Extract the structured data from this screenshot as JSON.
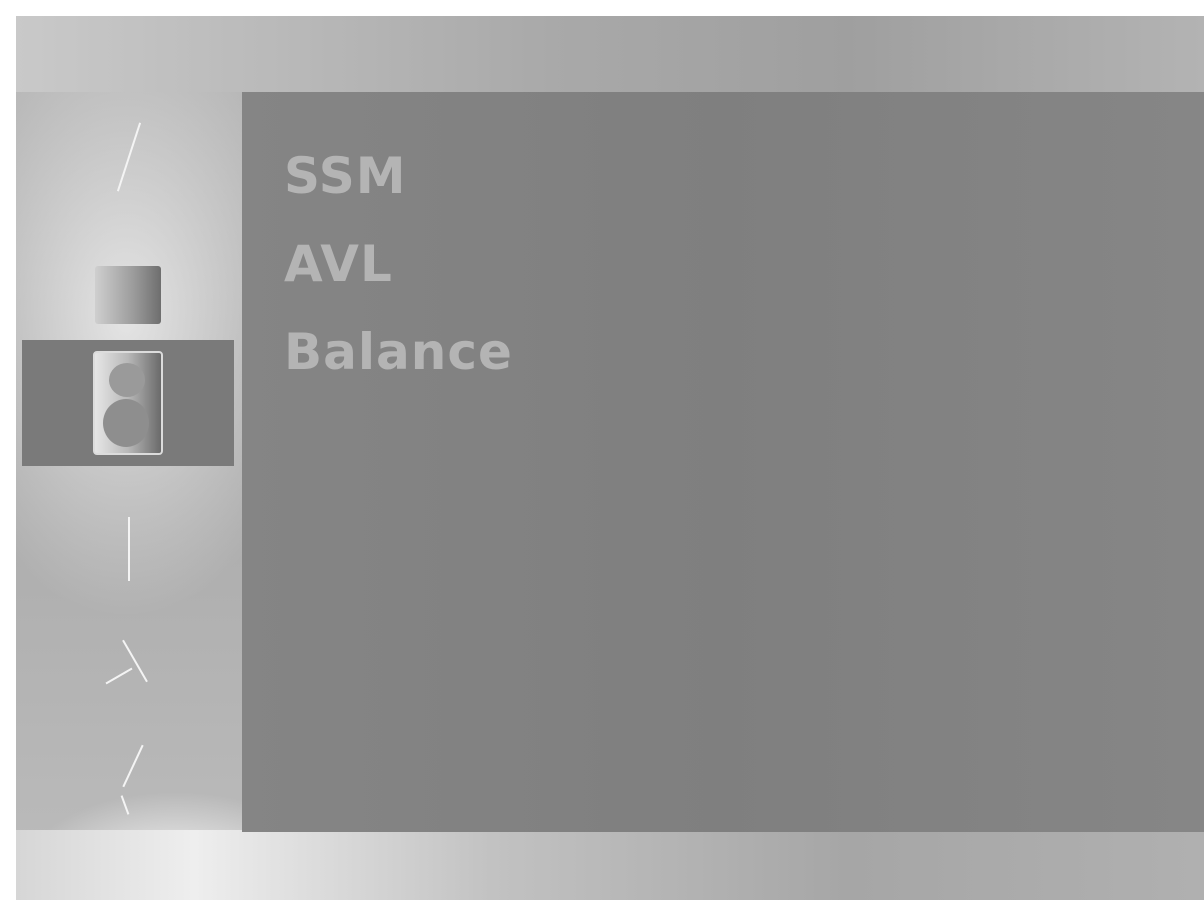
{
  "menu": {
    "items": [
      {
        "label": "SSM"
      },
      {
        "label": "AVL"
      },
      {
        "label": "Balance"
      }
    ]
  },
  "sidebar": {
    "icons": [
      {
        "name": "setup-icon"
      },
      {
        "name": "picture-icon"
      },
      {
        "name": "speaker-icon",
        "selected": true
      },
      {
        "name": "time-icon"
      },
      {
        "name": "special-icon"
      },
      {
        "name": "screen-icon"
      }
    ]
  },
  "colors": {
    "panel": "#808080",
    "selected_highlight": "#7a7a7a",
    "menu_text": "#b4b4b4"
  }
}
